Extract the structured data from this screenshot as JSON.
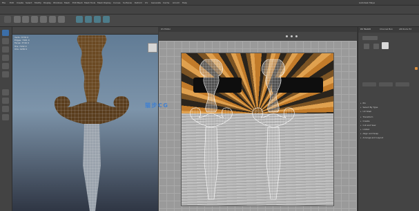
{
  "app": {
    "title": "Autodesk Maya"
  },
  "menubar": {
    "items": [
      "File",
      "Edit",
      "Create",
      "Select",
      "Modify",
      "Display",
      "Windows",
      "Mesh",
      "Edit Mesh",
      "Mesh Tools",
      "Mesh Display",
      "Curves",
      "Surfaces",
      "Deform",
      "UV",
      "Generate",
      "Cache",
      "Arnold",
      "Help"
    ]
  },
  "viewport": {
    "stats": [
      {
        "label": "Verts:",
        "a": "3776",
        "b": "0"
      },
      {
        "label": "Edges:",
        "a": "7491",
        "b": "0"
      },
      {
        "label": "Faces:",
        "a": "3716",
        "b": "0"
      },
      {
        "label": "Tris:",
        "a": "7432",
        "b": "0"
      },
      {
        "label": "UVs:",
        "a": "4230",
        "b": "0"
      }
    ]
  },
  "uv_editor": {
    "title": "UV Editor"
  },
  "right_panel": {
    "tabs": [
      "UV Toolkit",
      "Channel Box",
      "Attribute Ed"
    ],
    "sections": [
      {
        "label": "Pin"
      },
      {
        "label": "Select By Type"
      },
      {
        "label": "UV Shell"
      },
      {
        "label": "Transform"
      },
      {
        "label": "Create"
      },
      {
        "label": "Cut and Sew"
      },
      {
        "label": "Unfold"
      },
      {
        "label": "Align and Snap"
      },
      {
        "label": "Arrange and Layout"
      }
    ]
  },
  "watermark": {
    "text": "猫步CG"
  },
  "colors": {
    "accent": "#3a7fd6",
    "texture_orange": "#c27b2a",
    "bg": "#3a3a3a"
  }
}
